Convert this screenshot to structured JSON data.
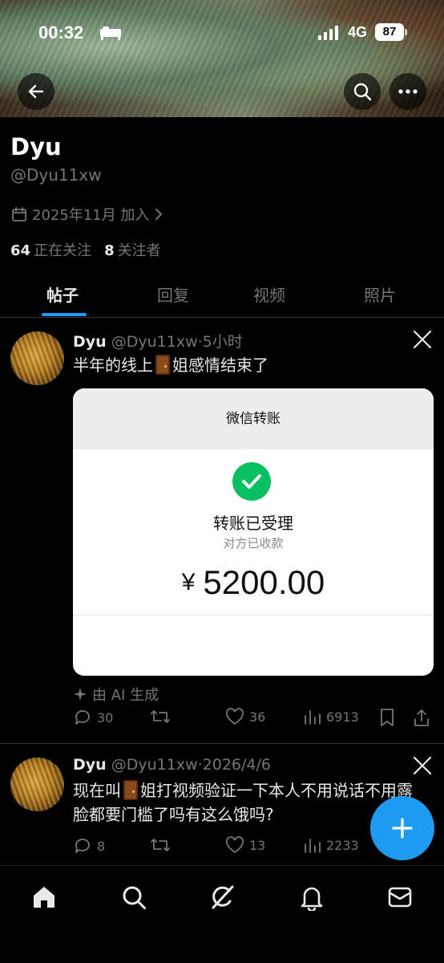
{
  "status_bar": {
    "time": "00:32",
    "network": "4G",
    "battery": "87"
  },
  "header": {
    "back_icon": "arrow-left-icon",
    "search_icon": "search-icon",
    "more_icon": "more-horizontal-icon"
  },
  "profile": {
    "name": "Dyu",
    "handle": "@Dyu11xw",
    "joined": "2025年11月 加入",
    "following_count": "64",
    "following_label": "正在关注",
    "followers_count": "8",
    "followers_label": "关注者"
  },
  "tabs": [
    {
      "label": "帖子",
      "active": true
    },
    {
      "label": "回复",
      "active": false
    },
    {
      "label": "视频",
      "active": false
    },
    {
      "label": "照片",
      "active": false
    }
  ],
  "posts": [
    {
      "name": "Dyu",
      "handle": "@Dyu11xw",
      "time": "5小时",
      "text_before": "半年的线上",
      "text_after": "姐感情结束了",
      "media": {
        "header": "微信转账",
        "status": "转账已受理",
        "substatus": "对方已收款",
        "currency": "¥",
        "amount": "5200.00"
      },
      "ai_label": "由 AI 生成",
      "replies": "30",
      "likes": "36",
      "views": "6913"
    },
    {
      "name": "Dyu",
      "handle": "@Dyu11xw",
      "time": "2026/4/6",
      "text_before": "现在叫",
      "text_after": "姐打视频验证一下本人不用说话不用露脸都要门槛了吗有这么饿吗?",
      "replies": "8",
      "likes": "13",
      "views": "2233"
    }
  ],
  "bottom_nav": [
    "home-icon",
    "search-icon",
    "grok-icon",
    "bell-icon",
    "mail-icon"
  ],
  "colors": {
    "accent": "#1d9bf0",
    "secondary_text": "#71767b",
    "wechat_green": "#07c160"
  }
}
